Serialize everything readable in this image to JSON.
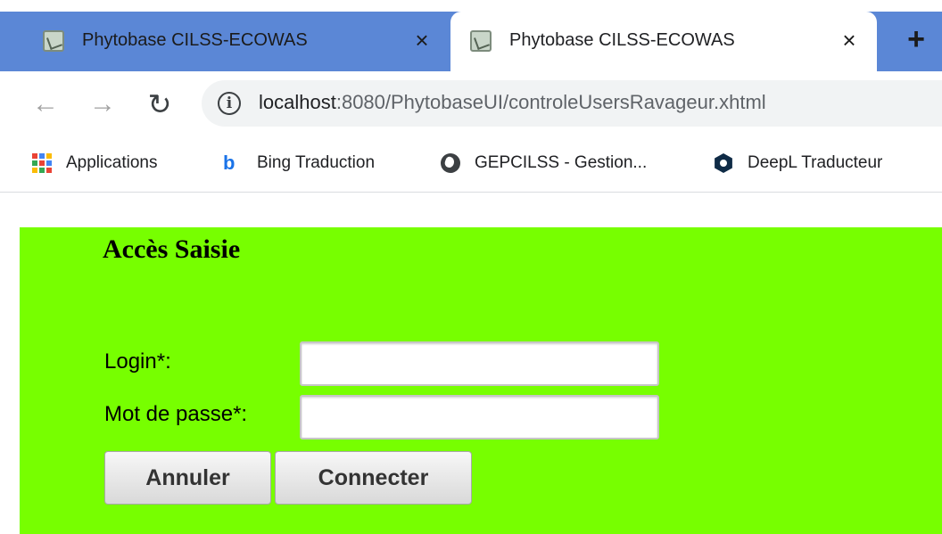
{
  "browser": {
    "tabs": [
      {
        "title": "Phytobase CILSS-ECOWAS",
        "close": "×"
      },
      {
        "title": "Phytobase CILSS-ECOWAS",
        "close": "×"
      }
    ],
    "new_tab": "+",
    "url_host": "localhost",
    "url_path": ":8080/PhytobaseUI/controleUsersRavageur.xhtml",
    "bookmarks": [
      {
        "label": "Applications",
        "icon": "apps-icon"
      },
      {
        "label": "Bing Traduction",
        "icon": "bing-icon"
      },
      {
        "label": "GEPCILSS - Gestion...",
        "icon": "globe-icon"
      },
      {
        "label": "DeepL Traducteur",
        "icon": "deepl-icon"
      }
    ]
  },
  "form": {
    "title": "Accès Saisie",
    "login_label": "Login*:",
    "password_label": "Mot de passe*:",
    "login_value": "",
    "password_value": "",
    "cancel_label": "Annuler",
    "connect_label": "Connecter"
  },
  "colors": {
    "page_background": "#77ff00",
    "tabstrip": "#5b87d6"
  }
}
